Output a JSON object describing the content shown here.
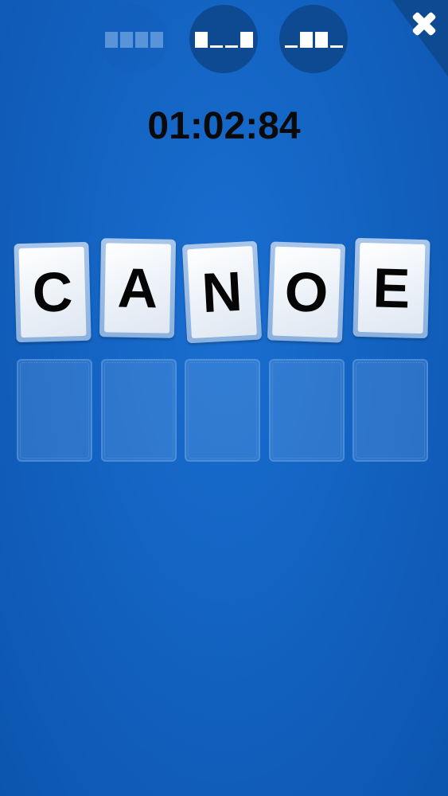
{
  "modes": [
    {
      "pattern": [
        "filled",
        "filled",
        "filled",
        "filled"
      ],
      "state": "inactive"
    },
    {
      "pattern": [
        "filled",
        "blank",
        "blank",
        "filled"
      ],
      "state": "active"
    },
    {
      "pattern": [
        "blank",
        "filled",
        "filled",
        "blank"
      ],
      "state": "active"
    }
  ],
  "close_icon": "close-icon",
  "colors": {
    "background": "#1363c2",
    "active_bubble": "#0d4a92",
    "corner": "#0d4a92"
  },
  "timer": "01:02:84",
  "letters": [
    "C",
    "A",
    "N",
    "O",
    "E"
  ],
  "slot_count": 5
}
